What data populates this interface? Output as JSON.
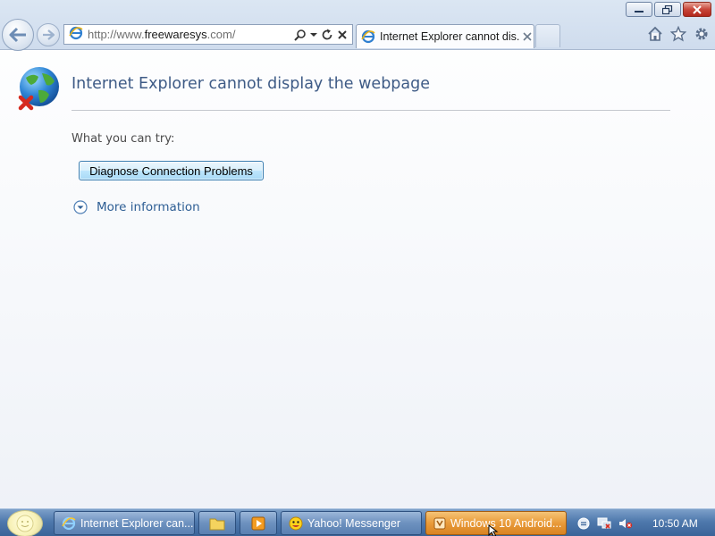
{
  "window": {
    "controls": [
      "minimize",
      "restore",
      "close"
    ]
  },
  "navbar": {
    "url_prefix": "http://www.",
    "url_domain": "freewaresys",
    "url_suffix": ".com/",
    "tab_title": "Internet Explorer cannot dis...",
    "icons": [
      "back-arrow-icon",
      "forward-arrow-icon",
      "ie-logo-icon",
      "search-icon",
      "dropdown-icon",
      "refresh-icon",
      "stop-icon",
      "home-icon",
      "favorites-star-icon",
      "tools-gear-icon"
    ]
  },
  "page": {
    "title": "Internet Explorer cannot display the webpage",
    "try_label": "What you can try:",
    "diagnose_button": "Diagnose Connection Problems",
    "more_info_label": "More information"
  },
  "taskbar": {
    "tasks": [
      {
        "label": "Internet Explorer can...",
        "icon": "ie-logo-icon",
        "active": false
      },
      {
        "label": "Yahoo! Messenger",
        "icon": "yahoo-messenger-icon",
        "active": false
      },
      {
        "label": "Windows 10 Android...",
        "icon": "media-icon",
        "active": true
      }
    ],
    "quick_launch": [
      "folder-icon",
      "media-player-icon"
    ],
    "tray_icons": [
      "messenger-status-icon",
      "network-icon",
      "volume-muted-icon"
    ],
    "clock": "10:50 AM"
  },
  "colors": {
    "title_blue": "#3e5b86",
    "link_blue": "#2e5e94",
    "taskbar_blue": "#4f79ad",
    "active_task_orange": "#e99b3a"
  }
}
